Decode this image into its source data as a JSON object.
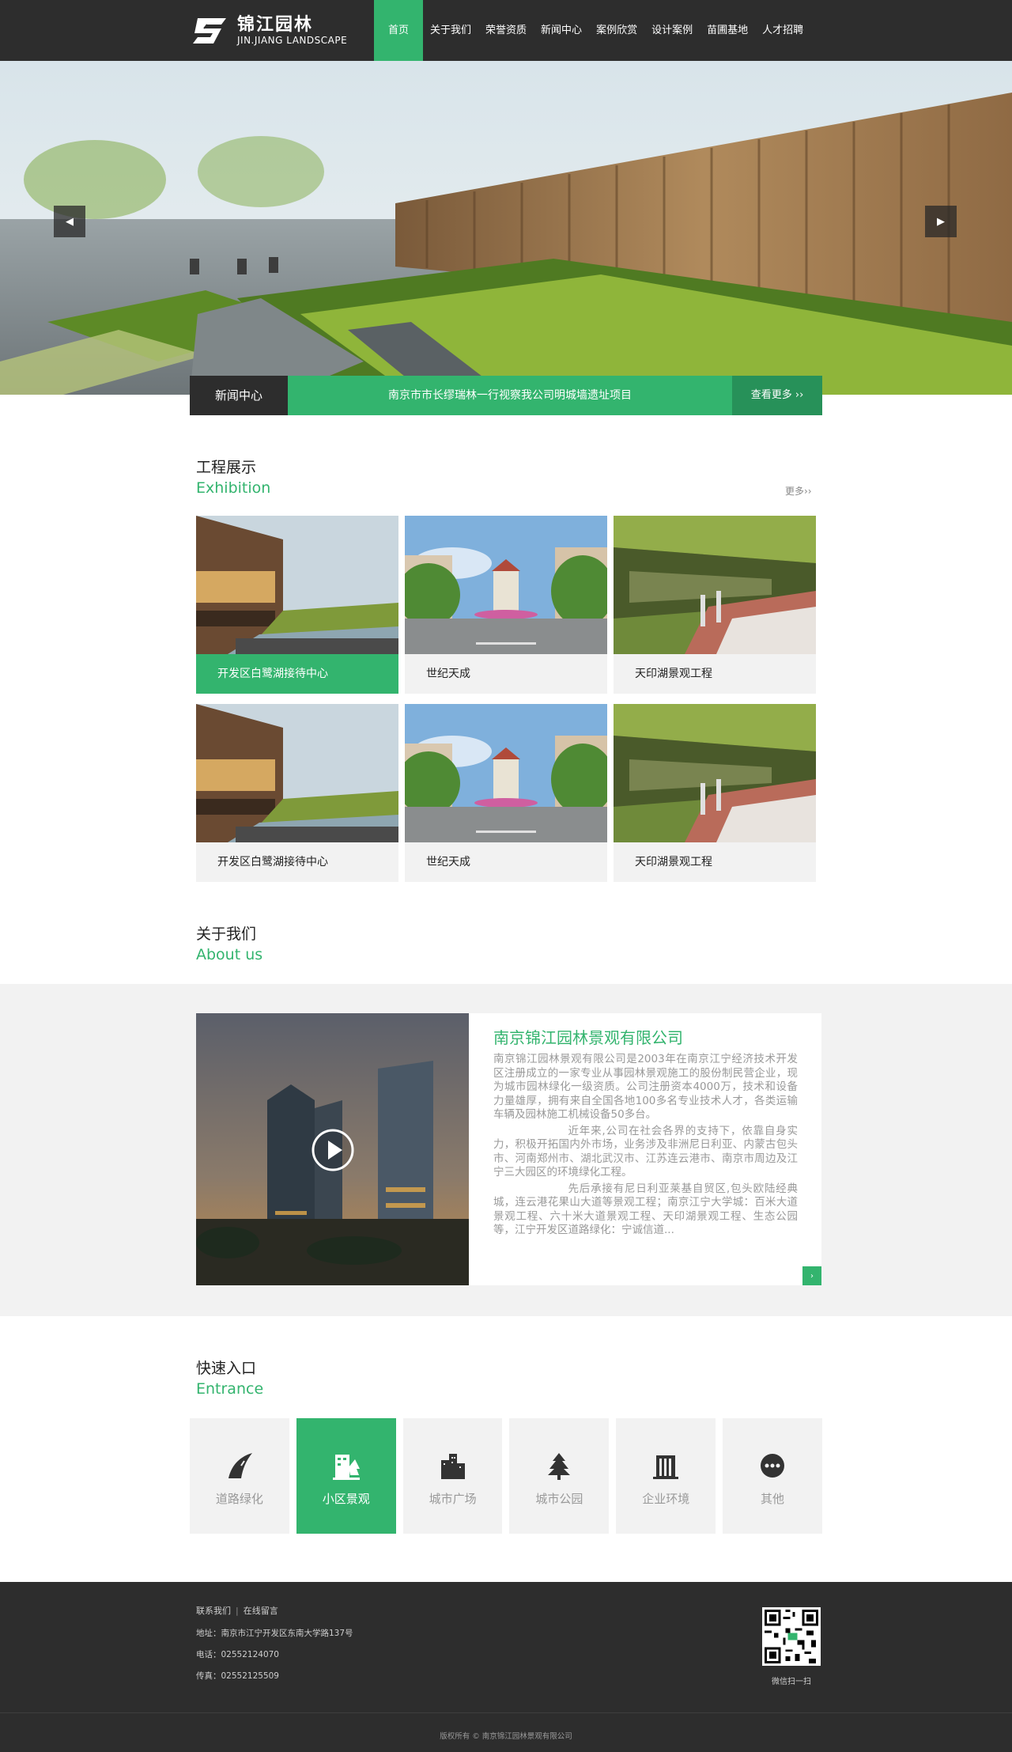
{
  "brand": {
    "name_cn": "锦江园林",
    "name_en": "JIN.JIANG LANDSCAPE"
  },
  "nav": [
    {
      "label": "首页",
      "active": true
    },
    {
      "label": "关于我们"
    },
    {
      "label": "荣誉资质"
    },
    {
      "label": "新闻中心"
    },
    {
      "label": "案例欣赏"
    },
    {
      "label": "设计案例"
    },
    {
      "label": "苗圃基地"
    },
    {
      "label": "人才招聘"
    }
  ],
  "news": {
    "label": "新闻中心",
    "headline": "南京市市长缪瑞林一行视察我公司明城墙遗址项目",
    "more": "查看更多 ››"
  },
  "exhibition": {
    "title_cn": "工程展示",
    "title_en": "Exhibition",
    "more": "更多››",
    "items": [
      {
        "caption": "开发区白鹭湖接待中心"
      },
      {
        "caption": "世纪天成"
      },
      {
        "caption": "天印湖景观工程"
      },
      {
        "caption": "开发区白鹭湖接待中心"
      },
      {
        "caption": "世纪天成"
      },
      {
        "caption": "天印湖景观工程"
      }
    ]
  },
  "about": {
    "title_cn": "关于我们",
    "title_en": "About us",
    "company": "南京锦江园林景观有限公司",
    "p1": "南京锦江园林景观有限公司是2003年在南京江宁经济技术开发区注册成立的一家专业从事园林景观施工的股份制民营企业，现为城市园林绿化一级资质。公司注册资本4000万，技术和设备力量雄厚，拥有来自全国各地100多名专业技术人才，各类运输车辆及园林施工机械设备50多台。",
    "p2": "近年来,公司在社会各界的支持下，依靠自身实力，积极开拓国内外市场，业务涉及非洲尼日利亚、内蒙古包头市、河南郑州市、湖北武汉市、江苏连云港市、南京市周边及江宁三大园区的环境绿化工程。",
    "p3": "先后承接有尼日利亚莱基自贸区,包头欧陆经典城，连云港花果山大道等景观工程；南京江宁大学城：百米大道景观工程、六十米大道景观工程、天印湖景观工程、生态公园等，江宁开发区道路绿化：宁诚信道...",
    "more_icon": "›"
  },
  "entrance": {
    "title_cn": "快速入口",
    "title_en": "Entrance",
    "items": [
      {
        "label": "道路绿化",
        "icon": "road-icon"
      },
      {
        "label": "小区景观",
        "icon": "residential-icon",
        "active": true
      },
      {
        "label": "城市广场",
        "icon": "city-buildings-icon"
      },
      {
        "label": "城市公园",
        "icon": "tree-icon"
      },
      {
        "label": "企业环境",
        "icon": "office-building-icon"
      },
      {
        "label": "其他",
        "icon": "more-dots-icon"
      }
    ]
  },
  "footer": {
    "contact": "联系我们",
    "message": "在线留言",
    "address": "地址：南京市江宁开发区东南大学路137号",
    "phone": "电话：02552124070",
    "fax": "传真：02552125509",
    "qr_caption": "微信扫一扫",
    "copyright": "版权所有 © 南京锦江园林景观有限公司"
  },
  "colors": {
    "accent": "#33b46e",
    "accent_dark": "#279159",
    "header_bg": "#2d2d2d",
    "band_bg": "#f2f2f2"
  }
}
